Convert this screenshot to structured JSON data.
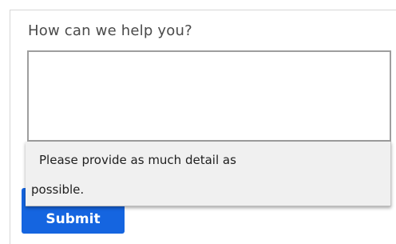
{
  "form": {
    "label": "How can we help you?",
    "textarea_value": "",
    "submit_label": "Submit"
  },
  "tooltip": {
    "line1": "Please provide as much detail as",
    "line2": "possible."
  },
  "colors": {
    "submit_bg": "#1565e0",
    "tooltip_bg": "#f0f0f0",
    "textarea_border": "#9e9e9e"
  }
}
